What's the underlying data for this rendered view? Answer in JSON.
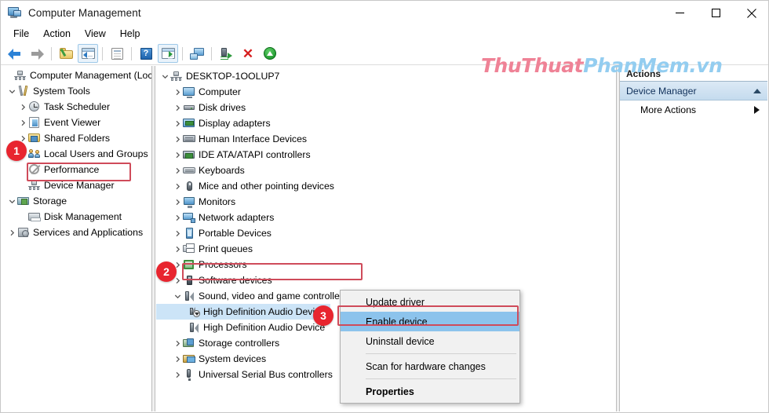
{
  "window": {
    "title": "Computer Management",
    "icon": "computer-management-icon",
    "controls": {
      "minimize": "–",
      "maximize": "□",
      "close": "✕"
    }
  },
  "menubar": {
    "items": [
      "File",
      "Action",
      "View",
      "Help"
    ]
  },
  "toolbar": {
    "buttons": [
      "back-arrow",
      "forward-arrow",
      "sep",
      "up-one-level",
      "show-hide-console-tree",
      "sep",
      "properties",
      "sep",
      "help",
      "show-hide-action-pane",
      "sep",
      "connect-to-another-computer",
      "sep",
      "update-driver",
      "uninstall-device",
      "scan-for-hardware-changes"
    ]
  },
  "watermark": {
    "part1": "ThuThuat",
    "part2": "PhanMem.vn"
  },
  "left_tree": {
    "items": [
      {
        "label": "Computer Management (Local",
        "icon": "computer-mgmt-icon",
        "indent": 0,
        "chevron": "none"
      },
      {
        "label": "System Tools",
        "icon": "tools-icon",
        "indent": 1,
        "chevron": "down"
      },
      {
        "label": "Task Scheduler",
        "icon": "clock-icon",
        "indent": 2,
        "chevron": "right"
      },
      {
        "label": "Event Viewer",
        "icon": "event-viewer-icon",
        "indent": 2,
        "chevron": "right"
      },
      {
        "label": "Shared Folders",
        "icon": "shared-folder-icon",
        "indent": 2,
        "chevron": "right"
      },
      {
        "label": "Local Users and Groups",
        "icon": "users-icon",
        "indent": 2,
        "chevron": "right"
      },
      {
        "label": "Performance",
        "icon": "performance-icon",
        "indent": 2,
        "chevron": "none"
      },
      {
        "label": "Device Manager",
        "icon": "device-manager-icon",
        "indent": 2,
        "chevron": "none"
      },
      {
        "label": "Storage",
        "icon": "storage-icon",
        "indent": 1,
        "chevron": "down"
      },
      {
        "label": "Disk Management",
        "icon": "disk-management-icon",
        "indent": 2,
        "chevron": "none"
      },
      {
        "label": "Services and Applications",
        "icon": "services-icon",
        "indent": 1,
        "chevron": "right"
      }
    ]
  },
  "device_tree": {
    "items": [
      {
        "label": "DESKTOP-1OOLUP7",
        "icon": "desktop-icon",
        "indent": 0,
        "chevron": "down",
        "selected": false
      },
      {
        "label": "Computer",
        "icon": "computer-icon",
        "indent": 1,
        "chevron": "right",
        "selected": false
      },
      {
        "label": "Disk drives",
        "icon": "disk-drive-icon",
        "indent": 1,
        "chevron": "right",
        "selected": false
      },
      {
        "label": "Display adapters",
        "icon": "display-adapter-icon",
        "indent": 1,
        "chevron": "right",
        "selected": false
      },
      {
        "label": "Human Interface Devices",
        "icon": "hid-icon",
        "indent": 1,
        "chevron": "right",
        "selected": false
      },
      {
        "label": "IDE ATA/ATAPI controllers",
        "icon": "ide-controller-icon",
        "indent": 1,
        "chevron": "right",
        "selected": false
      },
      {
        "label": "Keyboards",
        "icon": "keyboard-icon",
        "indent": 1,
        "chevron": "right",
        "selected": false
      },
      {
        "label": "Mice and other pointing devices",
        "icon": "mouse-icon",
        "indent": 1,
        "chevron": "right",
        "selected": false
      },
      {
        "label": "Monitors",
        "icon": "monitor-icon",
        "indent": 1,
        "chevron": "right",
        "selected": false
      },
      {
        "label": "Network adapters",
        "icon": "network-adapter-icon",
        "indent": 1,
        "chevron": "right",
        "selected": false
      },
      {
        "label": "Portable Devices",
        "icon": "portable-device-icon",
        "indent": 1,
        "chevron": "right",
        "selected": false
      },
      {
        "label": "Print queues",
        "icon": "printer-icon",
        "indent": 1,
        "chevron": "right",
        "selected": false
      },
      {
        "label": "Processors",
        "icon": "processor-icon",
        "indent": 1,
        "chevron": "right",
        "selected": false
      },
      {
        "label": "Software devices",
        "icon": "software-device-icon",
        "indent": 1,
        "chevron": "right",
        "selected": false
      },
      {
        "label": "Sound, video and game controllers",
        "icon": "speaker-icon",
        "indent": 1,
        "chevron": "down",
        "selected": false
      },
      {
        "label": "High Definition Audio Device",
        "icon": "speaker-disabled-icon",
        "indent": 2,
        "chevron": "none",
        "selected": true
      },
      {
        "label": "High Definition Audio Device",
        "icon": "speaker-icon",
        "indent": 2,
        "chevron": "none",
        "selected": false
      },
      {
        "label": "Storage controllers",
        "icon": "storage-controller-icon",
        "indent": 1,
        "chevron": "right",
        "selected": false
      },
      {
        "label": "System devices",
        "icon": "system-device-icon",
        "indent": 1,
        "chevron": "right",
        "selected": false
      },
      {
        "label": "Universal Serial Bus controllers",
        "icon": "usb-controller-icon",
        "indent": 1,
        "chevron": "right",
        "selected": false
      }
    ]
  },
  "actions_pane": {
    "header": "Actions",
    "group": "Device Manager",
    "items": [
      "More Actions"
    ]
  },
  "context_menu": {
    "items": [
      {
        "label": "Update driver",
        "highlighted": false,
        "bold": false,
        "separator_after": false
      },
      {
        "label": "Enable device",
        "highlighted": true,
        "bold": false,
        "separator_after": false
      },
      {
        "label": "Uninstall device",
        "highlighted": false,
        "bold": false,
        "separator_after": true
      },
      {
        "label": "Scan for hardware changes",
        "highlighted": false,
        "bold": false,
        "separator_after": true
      },
      {
        "label": "Properties",
        "highlighted": false,
        "bold": true,
        "separator_after": false
      }
    ]
  },
  "annotations": {
    "badges": [
      "1",
      "2",
      "3"
    ],
    "box_color": "#cf4b5a",
    "badge_color": "#e8252f"
  }
}
